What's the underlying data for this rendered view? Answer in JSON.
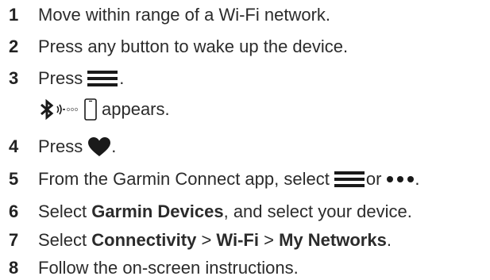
{
  "steps": [
    {
      "number": "1",
      "text": "Move within range of a Wi-Fi network."
    },
    {
      "number": "2",
      "text": "Press any button to wake up the device."
    },
    {
      "number": "3",
      "text_before": "Press",
      "text_after": "."
    },
    {
      "status_text": "appears."
    },
    {
      "number": "4",
      "text_before": "Press",
      "text_after": "."
    },
    {
      "number": "5",
      "text_before": "From the Garmin Connect app, select",
      "text_mid": "or",
      "text_after": "."
    },
    {
      "number": "6",
      "text_before": "Select",
      "bold_1": "Garmin Devices",
      "text_after": ", and select your device."
    },
    {
      "number": "7",
      "text_before": "Select",
      "bold_1": "Connectivity",
      "sep_1": ">",
      "bold_2": "Wi-Fi",
      "sep_2": ">",
      "bold_3": "My Networks",
      "text_after": "."
    },
    {
      "number": "8",
      "text": "Follow the on-screen instructions."
    }
  ],
  "icons": {
    "menu": "menu-icon",
    "heart": "heart-icon",
    "more": "more-dots-icon",
    "bluetooth": "bluetooth-icon",
    "signal": "signal-waves-icon",
    "phone": "phone-icon"
  },
  "colors": {
    "text": "#2b2b2b",
    "icon": "#1a1a1a",
    "background": "#ffffff"
  }
}
